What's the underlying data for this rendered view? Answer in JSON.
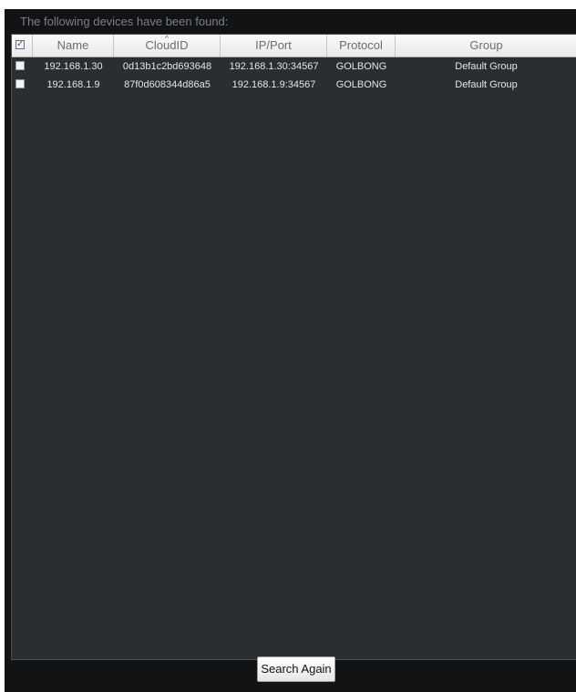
{
  "dialog": {
    "caption": "The following devices have been found:",
    "search_again_label": "Search Again"
  },
  "table": {
    "headers": {
      "name": "Name",
      "cloudid": "CloudID",
      "ipport": "IP/Port",
      "protocol": "Protocol",
      "group": "Group"
    },
    "select_all_checked": true,
    "sorted_column": "CloudID",
    "rows": [
      {
        "checked": false,
        "name": "192.168.1.30",
        "cloudid": "0d13b1c2bd693648",
        "ipport": "192.168.1.30:34567",
        "protocol": "GOLBONG",
        "group": "Default Group"
      },
      {
        "checked": false,
        "name": "192.168.1.9",
        "cloudid": "87f0d608344d86a5",
        "ipport": "192.168.1.9:34567",
        "protocol": "GOLBONG",
        "group": "Default Group"
      }
    ]
  },
  "colors": {
    "dialog_bg": "#121314",
    "table_bg": "#2a2d31",
    "row_text": "#e3e5e7"
  }
}
